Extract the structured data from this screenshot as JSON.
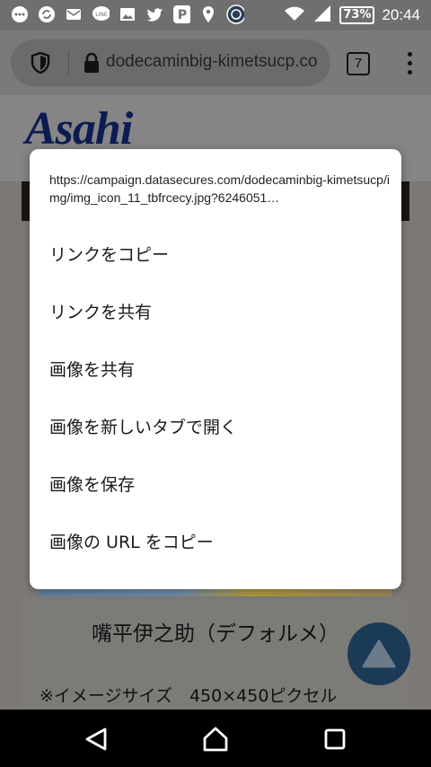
{
  "status_bar": {
    "icons": [
      "more-icon",
      "sync-icon",
      "mail-icon",
      "line-icon",
      "image-icon",
      "twitter-icon",
      "p-app-icon",
      "location-icon",
      "vpn-icon"
    ],
    "battery": "73%",
    "time": "20:44"
  },
  "browser": {
    "url": "dodecaminbig-kimetsucp.co",
    "tab_count": "7"
  },
  "page": {
    "logo": "Asahi",
    "character_title": "嘴平伊之助（デフォルメ）",
    "caption": "※イメージサイズ　450×450ピクセル"
  },
  "context_menu": {
    "image_url": "https://campaign.datasecures.com/dodecaminbig-kimetsucp/img/img_icon_11_tbfrcecy.jpg?6246051…",
    "items": [
      "リンクをコピー",
      "リンクを共有",
      "画像を共有",
      "画像を新しいタブで開く",
      "画像を保存",
      "画像の URL をコピー"
    ]
  }
}
